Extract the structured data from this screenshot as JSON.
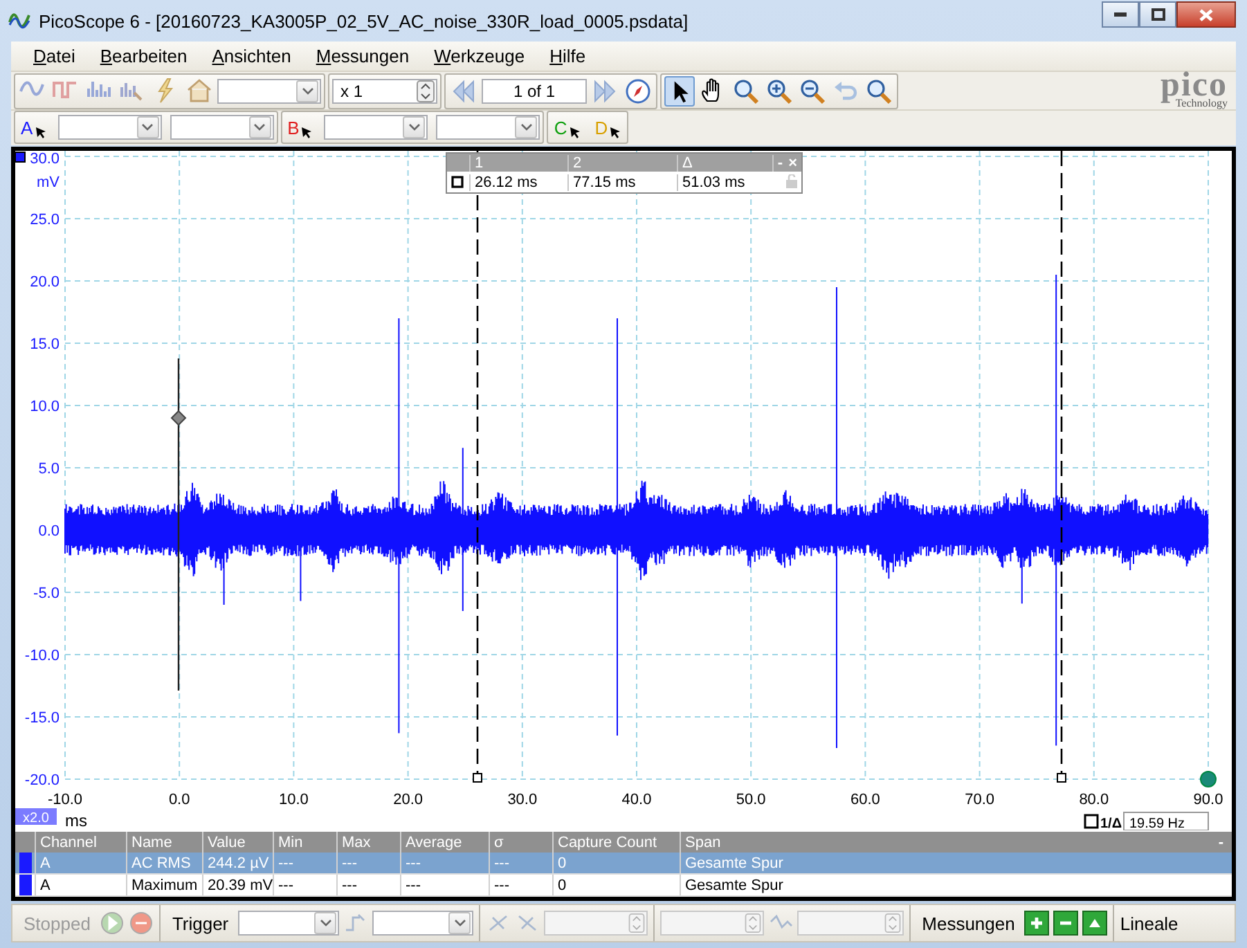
{
  "window": {
    "title": "PicoScope 6 - [20160723_KA3005P_02_5V_AC_noise_330R_load_0005.psdata]"
  },
  "menu": [
    {
      "label": "Datei"
    },
    {
      "label": "Bearbeiten"
    },
    {
      "label": "Ansichten"
    },
    {
      "label": "Messungen"
    },
    {
      "label": "Werkzeuge"
    },
    {
      "label": "Hilfe"
    }
  ],
  "toolbar": {
    "zoom_value": "x 1",
    "page": "1 of 1",
    "logo": "pico",
    "logo_tagline": "Technology"
  },
  "channels": [
    {
      "letter": "A",
      "color": "#1a1aff",
      "has_range": true
    },
    {
      "letter": "B",
      "color": "#e02020",
      "has_range": true
    },
    {
      "letter": "C",
      "color": "#10a010",
      "has_range": false
    },
    {
      "letter": "D",
      "color": "#d8a000",
      "has_range": false
    }
  ],
  "scope": {
    "y_unit": "mV",
    "y_labels": [
      "30.0",
      "25.0",
      "20.0",
      "15.0",
      "10.0",
      "5.0",
      "0.0",
      "-5.0",
      "-10.0",
      "-15.0",
      "-20.0"
    ],
    "x_unit": "ms",
    "x_labels": [
      "-10.0",
      "0.0",
      "10.0",
      "20.0",
      "30.0",
      "40.0",
      "50.0",
      "60.0",
      "70.0",
      "80.0",
      "90.0"
    ],
    "zoom_badge": "x2.0",
    "frequency_label": "1/Δ",
    "frequency": "19.59 Hz",
    "cursor_readout": {
      "headers": [
        "1",
        "2",
        "Δ"
      ],
      "values": [
        "26.12 ms",
        "77.15 ms",
        "51.03 ms"
      ],
      "minimize": "-",
      "close": "×",
      "checked": false
    }
  },
  "measurements": {
    "columns": [
      "Channel",
      "Name",
      "Value",
      "Min",
      "Max",
      "Average",
      "σ",
      "Capture Count",
      "Span"
    ],
    "minimize": "-",
    "rows": [
      {
        "selected": true,
        "cells": [
          "A",
          "AC RMS",
          "244.2 µV",
          "---",
          "---",
          "---",
          "---",
          "0",
          "Gesamte Spur"
        ]
      },
      {
        "selected": false,
        "cells": [
          "A",
          "Maximum",
          "20.39 mV",
          "---",
          "---",
          "---",
          "---",
          "0",
          "Gesamte Spur"
        ]
      }
    ]
  },
  "status_bar": {
    "state": "Stopped",
    "trigger": "Trigger",
    "measurements": "Messungen",
    "rulers": "Lineale"
  }
}
